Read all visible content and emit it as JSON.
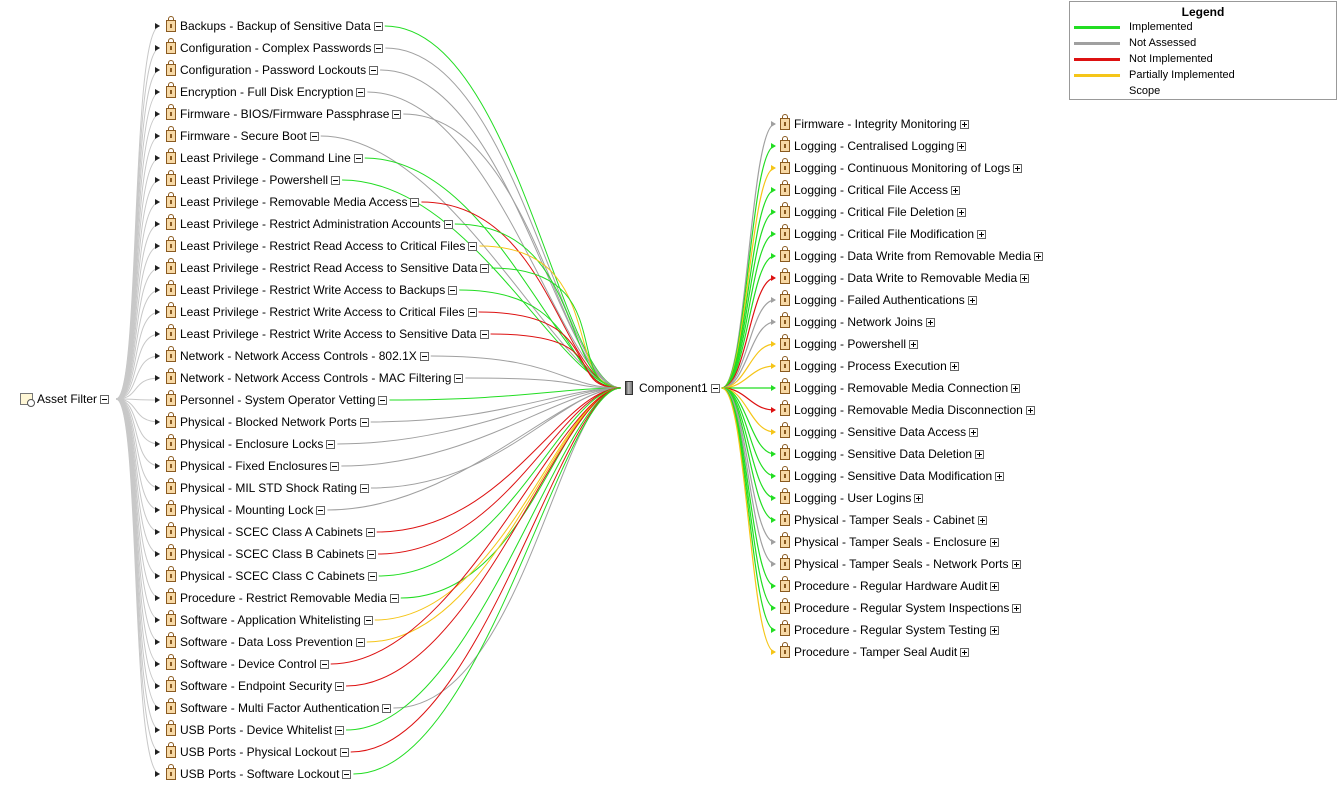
{
  "colors": {
    "implemented": "#22dd22",
    "not_assessed": "#a0a0a0",
    "not_implemented": "#dd1111",
    "partial": "#f5c518",
    "scope": "#c8c8c8"
  },
  "root": {
    "label": "Asset Filter",
    "icon": "asset-filter-icon"
  },
  "component": {
    "label": "Component1",
    "icon": "server-icon"
  },
  "left_nodes": [
    {
      "label": "Backups - Backup of Sensitive Data",
      "status": "implemented"
    },
    {
      "label": "Configuration - Complex Passwords",
      "status": "not_assessed"
    },
    {
      "label": "Configuration - Password Lockouts",
      "status": "not_assessed"
    },
    {
      "label": "Encryption - Full Disk Encryption",
      "status": "not_assessed"
    },
    {
      "label": "Firmware - BIOS/Firmware Passphrase",
      "status": "not_assessed"
    },
    {
      "label": "Firmware - Secure Boot",
      "status": "not_assessed"
    },
    {
      "label": "Least Privilege - Command Line",
      "status": "implemented"
    },
    {
      "label": "Least Privilege - Powershell",
      "status": "implemented"
    },
    {
      "label": "Least Privilege - Removable Media Access",
      "status": "not_implemented"
    },
    {
      "label": "Least Privilege - Restrict Administration Accounts",
      "status": "implemented"
    },
    {
      "label": "Least Privilege - Restrict Read Access to Critical Files",
      "status": "partial"
    },
    {
      "label": "Least Privilege - Restrict Read Access to Sensitive Data",
      "status": "implemented"
    },
    {
      "label": "Least Privilege - Restrict Write Access to Backups",
      "status": "implemented"
    },
    {
      "label": "Least Privilege - Restrict Write Access to Critical Files",
      "status": "not_implemented"
    },
    {
      "label": "Least Privilege - Restrict Write Access to Sensitive Data",
      "status": "not_implemented"
    },
    {
      "label": "Network -  Network Access Controls - 802.1X",
      "status": "not_assessed"
    },
    {
      "label": "Network -  Network Access Controls - MAC Filtering",
      "status": "not_assessed"
    },
    {
      "label": "Personnel - System Operator Vetting",
      "status": "implemented"
    },
    {
      "label": "Physical - Blocked Network Ports",
      "status": "not_assessed"
    },
    {
      "label": "Physical - Enclosure Locks",
      "status": "not_assessed"
    },
    {
      "label": "Physical - Fixed Enclosures",
      "status": "not_assessed"
    },
    {
      "label": "Physical - MIL STD Shock Rating",
      "status": "not_assessed"
    },
    {
      "label": "Physical - Mounting Lock",
      "status": "not_assessed"
    },
    {
      "label": "Physical - SCEC Class A Cabinets",
      "status": "not_implemented"
    },
    {
      "label": "Physical - SCEC Class B Cabinets",
      "status": "not_implemented"
    },
    {
      "label": "Physical - SCEC Class C Cabinets",
      "status": "implemented"
    },
    {
      "label": "Procedure - Restrict Removable Media",
      "status": "implemented"
    },
    {
      "label": "Software - Application Whitelisting",
      "status": "partial"
    },
    {
      "label": "Software - Data Loss Prevention",
      "status": "partial"
    },
    {
      "label": "Software - Device Control",
      "status": "not_implemented"
    },
    {
      "label": "Software - Endpoint Security",
      "status": "not_implemented"
    },
    {
      "label": "Software - Multi Factor Authentication",
      "status": "not_assessed"
    },
    {
      "label": "USB Ports - Device Whitelist",
      "status": "implemented"
    },
    {
      "label": "USB Ports - Physical Lockout",
      "status": "not_implemented"
    },
    {
      "label": "USB Ports - Software Lockout",
      "status": "implemented"
    }
  ],
  "right_nodes": [
    {
      "label": "Firmware - Integrity Monitoring",
      "status": "not_assessed"
    },
    {
      "label": "Logging - Centralised Logging",
      "status": "implemented"
    },
    {
      "label": "Logging - Continuous Monitoring of Logs",
      "status": "partial"
    },
    {
      "label": "Logging - Critical File Access",
      "status": "implemented"
    },
    {
      "label": "Logging - Critical File Deletion",
      "status": "implemented"
    },
    {
      "label": "Logging - Critical File Modification",
      "status": "implemented"
    },
    {
      "label": "Logging - Data Write from Removable Media",
      "status": "implemented"
    },
    {
      "label": "Logging - Data Write to Removable Media",
      "status": "not_implemented"
    },
    {
      "label": "Logging - Failed Authentications",
      "status": "not_assessed"
    },
    {
      "label": "Logging - Network Joins",
      "status": "not_assessed"
    },
    {
      "label": "Logging - Powershell",
      "status": "partial"
    },
    {
      "label": "Logging - Process Execution",
      "status": "partial"
    },
    {
      "label": "Logging - Removable Media Connection",
      "status": "implemented"
    },
    {
      "label": "Logging - Removable Media Disconnection",
      "status": "not_implemented"
    },
    {
      "label": "Logging - Sensitive Data Access",
      "status": "partial"
    },
    {
      "label": "Logging - Sensitive Data Deletion",
      "status": "implemented"
    },
    {
      "label": "Logging - Sensitive Data Modification",
      "status": "implemented"
    },
    {
      "label": "Logging - User Logins",
      "status": "implemented"
    },
    {
      "label": "Physical - Tamper Seals - Cabinet",
      "status": "implemented"
    },
    {
      "label": "Physical - Tamper Seals - Enclosure",
      "status": "not_assessed"
    },
    {
      "label": "Physical - Tamper Seals - Network Ports",
      "status": "not_assessed"
    },
    {
      "label": "Procedure - Regular Hardware Audit",
      "status": "implemented"
    },
    {
      "label": "Procedure - Regular System Inspections",
      "status": "implemented"
    },
    {
      "label": "Procedure - Regular System Testing",
      "status": "implemented"
    },
    {
      "label": "Procedure - Tamper Seal Audit",
      "status": "partial"
    }
  ],
  "legend": {
    "title": "Legend",
    "items": [
      {
        "label": "Implemented",
        "color": "#22dd22"
      },
      {
        "label": "Not Assessed",
        "color": "#a0a0a0"
      },
      {
        "label": "Not Implemented",
        "color": "#dd1111"
      },
      {
        "label": "Partially Implemented",
        "color": "#f5c518"
      },
      {
        "label": "Scope",
        "color": "#ffffff"
      }
    ]
  }
}
